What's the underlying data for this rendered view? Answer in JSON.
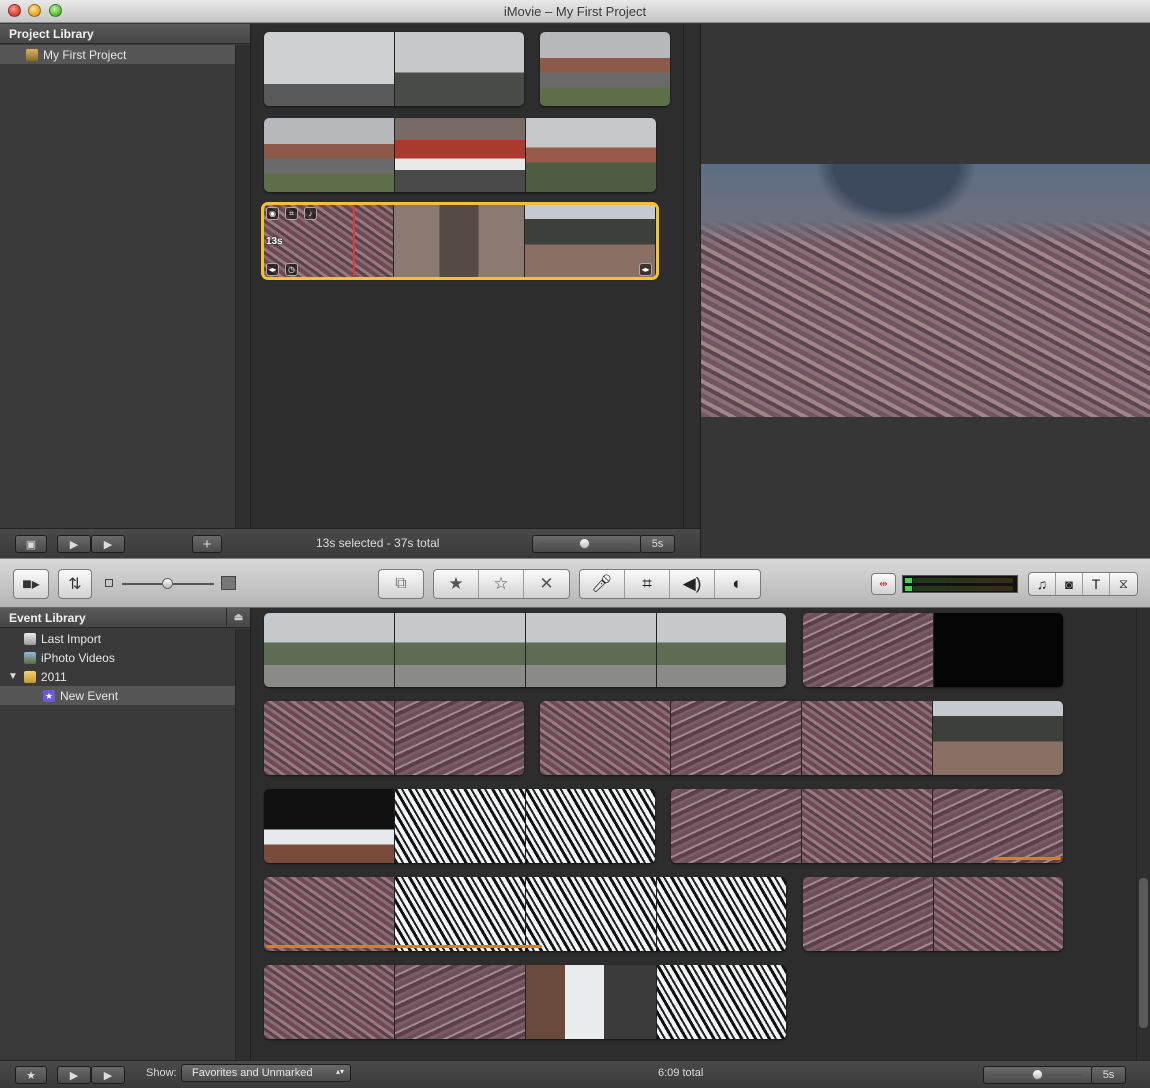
{
  "window": {
    "title": "iMovie – My First Project"
  },
  "project_library": {
    "header": "Project Library",
    "items": [
      {
        "label": "My First Project",
        "icon": "project-icon"
      }
    ]
  },
  "project_browser": {
    "selected_clip_duration": "13s",
    "status": "13s selected - 37s total",
    "zoom_label": "5s"
  },
  "event_library": {
    "header": "Event Library",
    "items": [
      {
        "label": "Last Import",
        "icon": "last-import-icon"
      },
      {
        "label": "iPhoto Videos",
        "icon": "iphoto-icon"
      },
      {
        "label": "2011",
        "icon": "calendar-icon",
        "expanded": true
      },
      {
        "label": "New Event",
        "icon": "star-event-icon",
        "selected": true
      }
    ]
  },
  "event_browser": {
    "show_label": "Show:",
    "show_value": "Favorites and Unmarked",
    "total": "6:09 total",
    "zoom_label": "5s"
  },
  "toolbar": {
    "tools": [
      "camera-icon",
      "swap-icon",
      "add-to-project-icon",
      "favorite-icon",
      "unfavorite-icon",
      "reject-icon",
      "voiceover-icon",
      "crop-icon",
      "audio-adjust-icon",
      "color-adjust-icon",
      "waveform-toggle-icon",
      "music-icon",
      "photo-icon",
      "title-icon",
      "transition-icon"
    ],
    "text_tool_label": "T"
  },
  "colors": {
    "selection": "#f2c32b",
    "favorite_marker": "#e07b1f",
    "playhead": "#e03a3a"
  }
}
